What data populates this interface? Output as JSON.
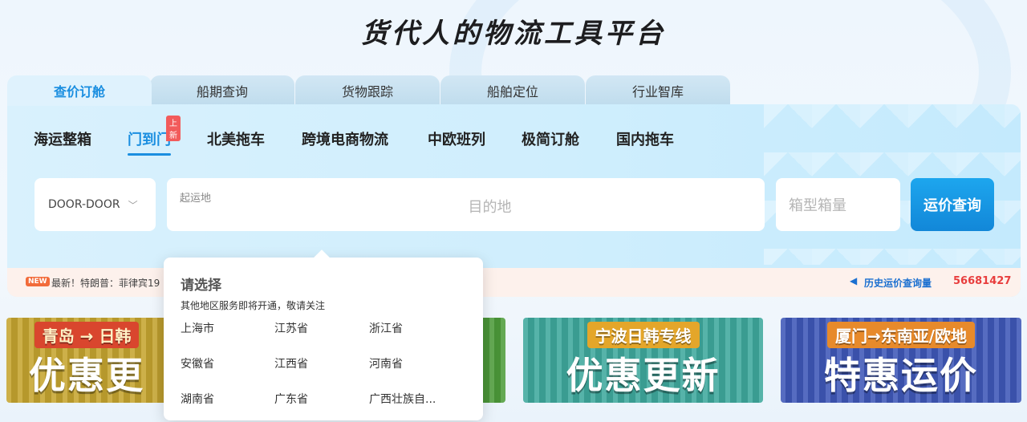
{
  "page": {
    "title": "货代人的物流工具平台"
  },
  "tabs": [
    {
      "label": "查价订舱",
      "active": true
    },
    {
      "label": "船期查询",
      "active": false
    },
    {
      "label": "货物跟踪",
      "active": false
    },
    {
      "label": "船舶定位",
      "active": false
    },
    {
      "label": "行业智库",
      "active": false
    }
  ],
  "subnav": {
    "items": [
      {
        "label": "海运整箱",
        "active": false
      },
      {
        "label": "门到门",
        "active": true
      },
      {
        "label": "北美拖车",
        "active": false
      },
      {
        "label": "跨境电商物流",
        "active": false
      },
      {
        "label": "中欧班列",
        "active": false
      },
      {
        "label": "极简订舱",
        "active": false
      },
      {
        "label": "国内拖车",
        "active": false
      }
    ],
    "badge": "上新"
  },
  "search": {
    "mode_value": "DOOR-DOOR",
    "origin_label": "起运地",
    "destination_placeholder": "目的地",
    "box_placeholder": "箱型箱量",
    "query_button": "运价查询"
  },
  "news": {
    "tag": "NEW",
    "text": "最新！特朗普：菲律宾19",
    "history_label": "历史运价查询量",
    "history_count": "56681427"
  },
  "banners": [
    {
      "top": "青岛 → 日韩",
      "main": "优惠更"
    },
    {
      "top": "",
      "main": ""
    },
    {
      "top": "宁波日韩专线",
      "main": "优惠更新"
    },
    {
      "top": "厦门→东南亚/欧地",
      "main": "特惠运价"
    }
  ],
  "popup": {
    "title": "请选择",
    "subtitle": "其他地区服务即将开通，敬请关注",
    "regions": [
      "上海市",
      "江苏省",
      "浙江省",
      "安徽省",
      "江西省",
      "河南省",
      "湖南省",
      "广东省",
      "广西壮族自..."
    ]
  }
}
